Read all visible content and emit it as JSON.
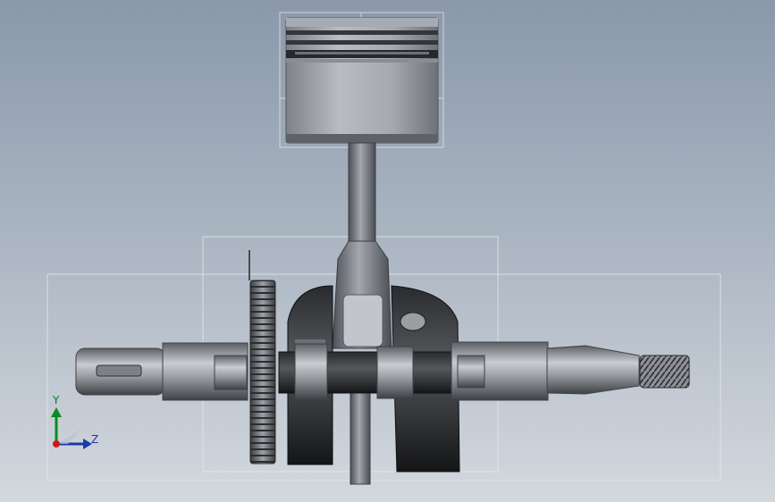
{
  "viewport": {
    "colors": {
      "background_top": "#8a98aa",
      "background_bottom": "#d3d8de",
      "metal_light": "#c6c9ce",
      "metal_dark": "#1b1c1e",
      "bbox_line": "#e6e9ee"
    }
  },
  "triad": {
    "y_label": "Y",
    "z_label": "Z",
    "x_color": "#d4131b",
    "y_color": "#0b8a22",
    "z_color": "#1a3aa8"
  },
  "model": {
    "parts": [
      "piston",
      "connecting-rod",
      "crankshaft",
      "gear",
      "counterweight",
      "threaded-end"
    ]
  }
}
